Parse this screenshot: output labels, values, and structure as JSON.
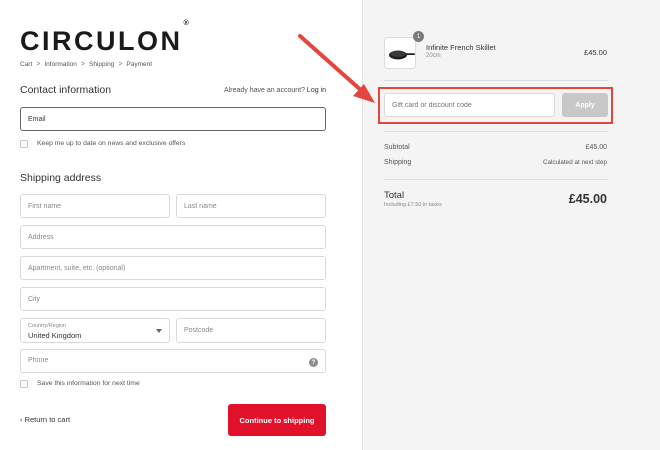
{
  "brand": {
    "logo": "CIRCULON",
    "mark": "®"
  },
  "breadcrumb": {
    "items": [
      "Cart",
      "Information",
      "Shipping",
      "Payment"
    ],
    "separator": ">"
  },
  "contact": {
    "title": "Contact information",
    "account_prompt": "Already have an account?",
    "login_link": "Log in",
    "email_placeholder": "Email",
    "newsletter_label": "Keep me up to date on news and exclusive offers"
  },
  "shipping": {
    "title": "Shipping address",
    "first_name": "First name",
    "last_name": "Last name",
    "address": "Address",
    "apartment": "Apartment, suite, etc. (optional)",
    "city": "City",
    "country_label": "Country/Region",
    "country_value": "United Kingdom",
    "postcode": "Postcode",
    "phone": "Phone",
    "help_glyph": "?",
    "save_label": "Save this information for next time"
  },
  "footer": {
    "back_glyph": "‹",
    "back_label": "Return to cart",
    "continue_label": "Continue to shipping"
  },
  "summary": {
    "item": {
      "qty": "1",
      "name": "Infinite French Skillet",
      "size": "20cm",
      "price": "£45.00"
    },
    "discount_placeholder": "Gift card or discount code",
    "apply_label": "Apply",
    "subtotal_label": "Subtotal",
    "subtotal_value": "£45.00",
    "shipping_label": "Shipping",
    "shipping_value": "Calculated at next step",
    "total_label": "Total",
    "total_sub": "Including £7.50 in taxes",
    "total_value": "£45.00"
  },
  "colors": {
    "accent": "#e1112b",
    "annotation": "#e4463d",
    "sidebar_bg": "#f4f4f4"
  }
}
